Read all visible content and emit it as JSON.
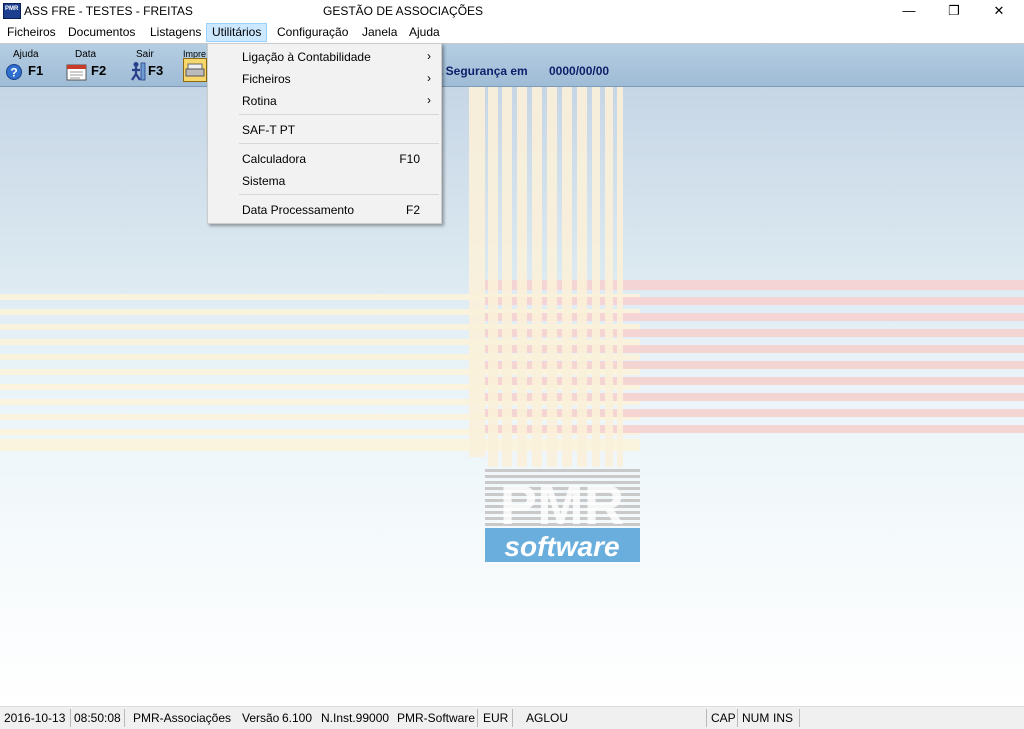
{
  "window": {
    "title": "ASS FRE - TESTES - FREITAS",
    "center_title": "GESTÃO DE ASSOCIAÇÕES",
    "app_icon_text": "PMR",
    "controls": {
      "minimize": "—",
      "restore": "❐",
      "close": "✕"
    }
  },
  "menubar": {
    "items": [
      {
        "label": "Ficheiros"
      },
      {
        "label": "Documentos"
      },
      {
        "label": "Listagens"
      },
      {
        "label": "Utilitários"
      },
      {
        "label": "Configuração"
      },
      {
        "label": "Janela"
      },
      {
        "label": "Ajuda"
      }
    ],
    "active": "Utilitários"
  },
  "toolbar": {
    "buttons": [
      {
        "label": "Ajuda",
        "key": "F1",
        "icon": "help-icon"
      },
      {
        "label": "Data",
        "key": "F2",
        "icon": "calendar-icon"
      },
      {
        "label": "Sair",
        "key": "F3",
        "icon": "exit-icon"
      },
      {
        "label": "Impre",
        "key": "",
        "icon": "printer-icon"
      }
    ],
    "info_text": "ma Segurança em",
    "info_date": "0000/00/00"
  },
  "dropdown": {
    "items": [
      {
        "label": "Ligação à Contabilidade",
        "shortcut": "",
        "submenu": true
      },
      {
        "label": "Ficheiros",
        "shortcut": "",
        "submenu": true
      },
      {
        "label": "Rotina",
        "shortcut": "",
        "submenu": true
      },
      {
        "label": "SAF-T PT",
        "shortcut": "",
        "submenu": false
      },
      {
        "label": "Calculadora",
        "shortcut": "F10",
        "submenu": false
      },
      {
        "label": "Sistema",
        "shortcut": "",
        "submenu": false
      },
      {
        "label": "Data Processamento",
        "shortcut": "F2",
        "submenu": false
      }
    ],
    "submenu_arrow": "›"
  },
  "logo": {
    "brand": "PMR",
    "tagline": "software"
  },
  "statusbar": {
    "date": "2016-10-13",
    "time": "08:50:08",
    "app": "PMR-Associações",
    "version_label": "Versão",
    "version": "6.100",
    "inst": "N.Inst.99000",
    "vendor": "PMR-Software",
    "currency": "EUR",
    "user": "AGLOU",
    "cap": "CAP",
    "num": "NUM",
    "ins": "INS"
  },
  "colors": {
    "menu_active_bg": "#cce8ff",
    "toolbar_bg": "#a9c4dc",
    "info_text": "#0f1f6a",
    "logo_blue": "#5aa5d8"
  }
}
